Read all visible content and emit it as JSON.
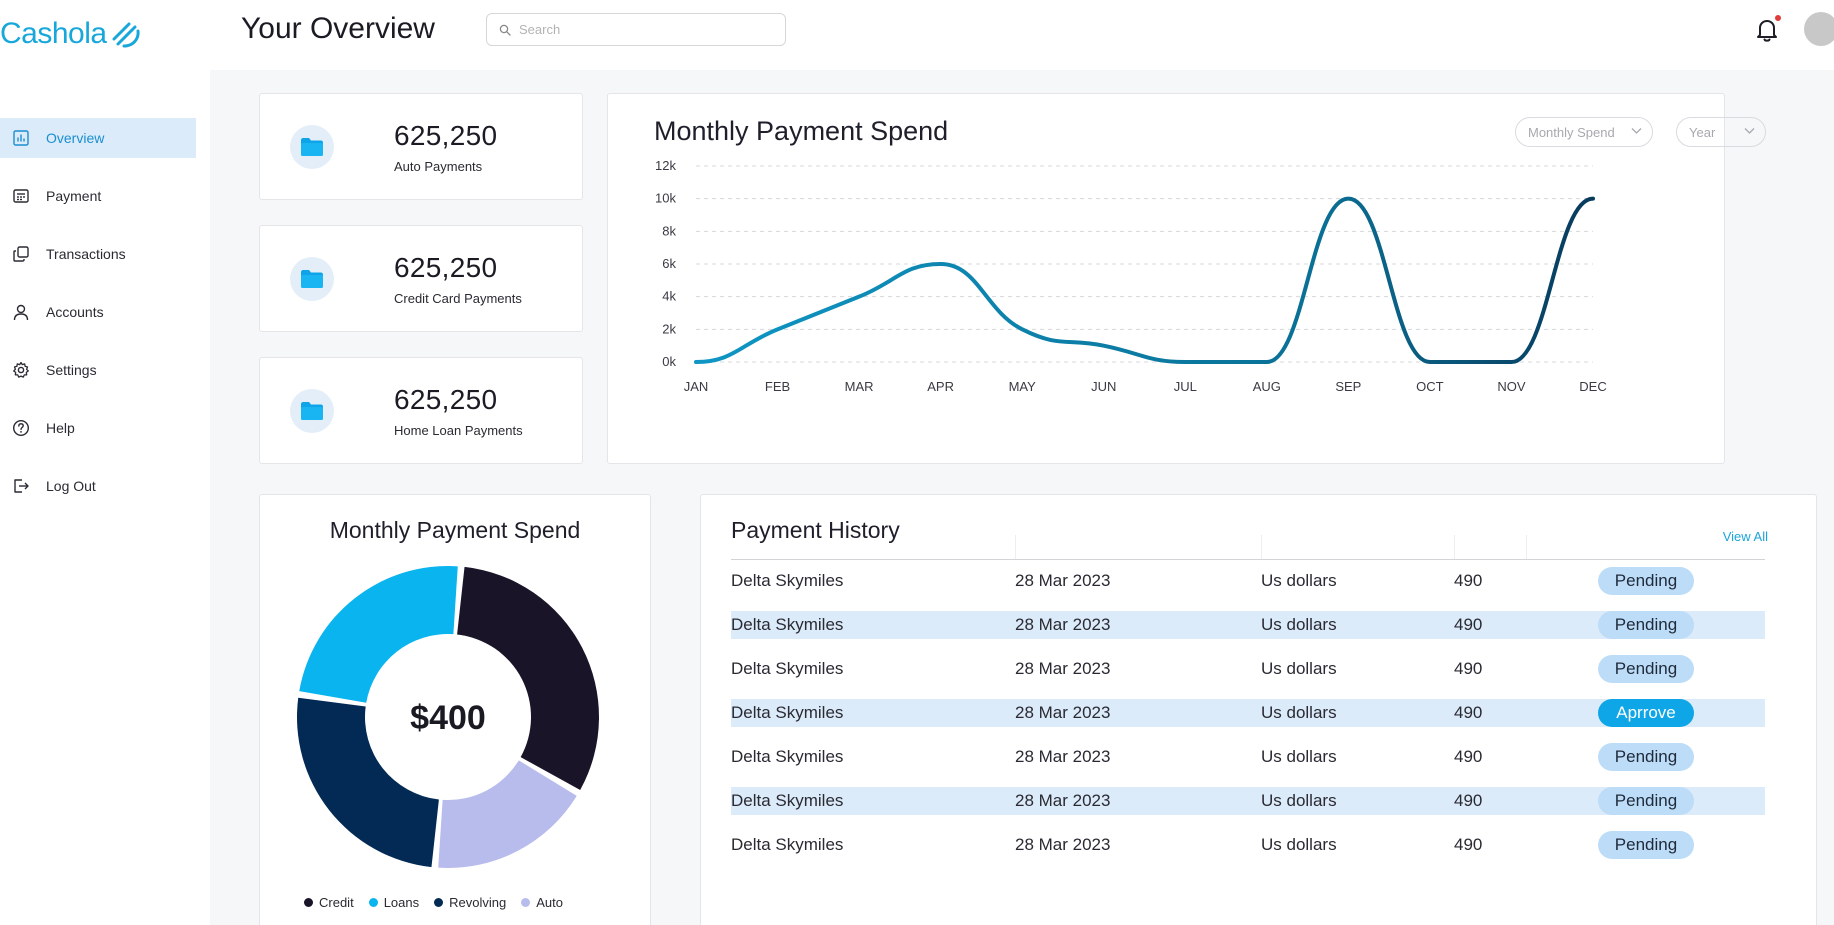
{
  "brand": {
    "name": "Cashola"
  },
  "header": {
    "title": "Your Overview",
    "search_placeholder": "Search"
  },
  "sidebar": {
    "items": [
      {
        "label": "Overview",
        "icon": "bar-chart-icon",
        "active": true
      },
      {
        "label": "Payment",
        "icon": "calculator-icon",
        "active": false
      },
      {
        "label": "Transactions",
        "icon": "copy-icon",
        "active": false
      },
      {
        "label": "Accounts",
        "icon": "user-icon",
        "active": false
      },
      {
        "label": "Settings",
        "icon": "gear-icon",
        "active": false
      },
      {
        "label": "Help",
        "icon": "help-circle-icon",
        "active": false
      },
      {
        "label": "Log Out",
        "icon": "logout-icon",
        "active": false
      }
    ]
  },
  "stats": [
    {
      "value": "625,250",
      "label": "Auto Payments",
      "icon": "folder-icon"
    },
    {
      "value": "625,250",
      "label": "Credit Card Payments",
      "icon": "folder-icon"
    },
    {
      "value": "625,250",
      "label": "Home Loan Payments",
      "icon": "folder-icon"
    }
  ],
  "line_chart": {
    "title": "Monthly Payment Spend",
    "dropdowns": [
      "Monthly Spend",
      "Year"
    ]
  },
  "donut_chart": {
    "title": "Monthly Payment Spend",
    "center_label": "$400"
  },
  "payment_history": {
    "title": "Payment History",
    "view_all": "View All",
    "rows": [
      {
        "name": "Delta Skymiles",
        "date": "28 Mar 2023",
        "currency": "Us dollars",
        "amount": "490",
        "status": "Pending"
      },
      {
        "name": "Delta Skymiles",
        "date": "28 Mar 2023",
        "currency": "Us dollars",
        "amount": "490",
        "status": "Pending"
      },
      {
        "name": "Delta Skymiles",
        "date": "28 Mar 2023",
        "currency": "Us dollars",
        "amount": "490",
        "status": "Pending"
      },
      {
        "name": "Delta Skymiles",
        "date": "28 Mar 2023",
        "currency": "Us dollars",
        "amount": "490",
        "status": "Aprrove"
      },
      {
        "name": "Delta Skymiles",
        "date": "28 Mar 2023",
        "currency": "Us dollars",
        "amount": "490",
        "status": "Pending"
      },
      {
        "name": "Delta Skymiles",
        "date": "28 Mar 2023",
        "currency": "Us dollars",
        "amount": "490",
        "status": "Pending"
      },
      {
        "name": "Delta Skymiles",
        "date": "28 Mar 2023",
        "currency": "Us dollars",
        "amount": "490",
        "status": "Pending"
      }
    ]
  },
  "colors": {
    "accent": "#17a7da",
    "active_nav_bg": "#dcebf9",
    "line": "#0a7ea4",
    "pending_bg": "#bcdcf7",
    "approve_bg": "#0ea6e6"
  },
  "chart_data": [
    {
      "type": "line",
      "title": "Monthly Payment Spend",
      "x": [
        "JAN",
        "FEB",
        "MAR",
        "APR",
        "MAY",
        "JUN",
        "JUL",
        "AUG",
        "SEP",
        "OCT",
        "NOV",
        "DEC"
      ],
      "values": [
        0,
        2000,
        4000,
        6000,
        2000,
        1000,
        0,
        0,
        10000,
        0,
        0,
        10000
      ],
      "yticks": [
        "0k",
        "2k",
        "4k",
        "6k",
        "8k",
        "10k",
        "12k"
      ],
      "ylim": [
        0,
        12000
      ],
      "grid": true,
      "legend": "none"
    },
    {
      "type": "pie",
      "title": "Monthly Payment Spend",
      "center_text": "$400",
      "categories": [
        "Credit",
        "Loans",
        "Revolving",
        "Auto"
      ],
      "values": [
        32,
        24,
        26,
        18
      ],
      "colors": [
        "#1a1429",
        "#0ab4ee",
        "#032a55",
        "#b8bcec"
      ],
      "legend": "bottom"
    }
  ]
}
